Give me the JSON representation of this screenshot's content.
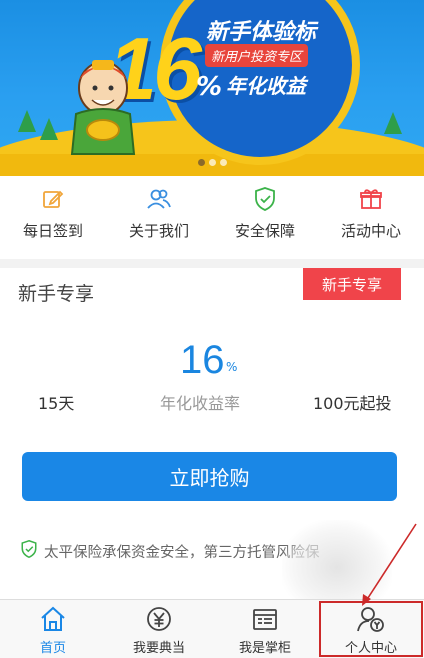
{
  "banner": {
    "rate": "16",
    "percent": "%",
    "headline": "新手体验标",
    "subhead": "新用户投资专区",
    "yield_text": "年化收益",
    "active_dot": 0,
    "dot_count": 3
  },
  "shortcuts": [
    {
      "label": "每日签到",
      "icon": "edit-icon",
      "color": "#f0a53a"
    },
    {
      "label": "关于我们",
      "icon": "users-icon",
      "color": "#3a8fe0"
    },
    {
      "label": "安全保障",
      "icon": "shield-check-icon",
      "color": "#3cb34a"
    },
    {
      "label": "活动中心",
      "icon": "gift-icon",
      "color": "#f0444a"
    }
  ],
  "card": {
    "title": "新手专享",
    "ribbon": "新手专享",
    "rate_value": "16",
    "rate_unit": "%",
    "term": "15天",
    "rate_label": "年化收益率",
    "min_amount": "100元起投",
    "buy_label": "立即抢购",
    "security_text": "太平保险承保资金安全，第三方托管风险保"
  },
  "tabbar": {
    "tabs": [
      {
        "label": "首页",
        "icon": "home-icon",
        "active": true
      },
      {
        "label": "我要典当",
        "icon": "yuan-icon",
        "active": false
      },
      {
        "label": "我是掌柜",
        "icon": "ledger-icon",
        "active": false
      },
      {
        "label": "个人中心",
        "icon": "user-yuan-icon",
        "active": false
      }
    ]
  },
  "colors": {
    "primary": "#1a87e6",
    "accent_red": "#f0444a",
    "annotation_red": "#cc2a2a"
  }
}
